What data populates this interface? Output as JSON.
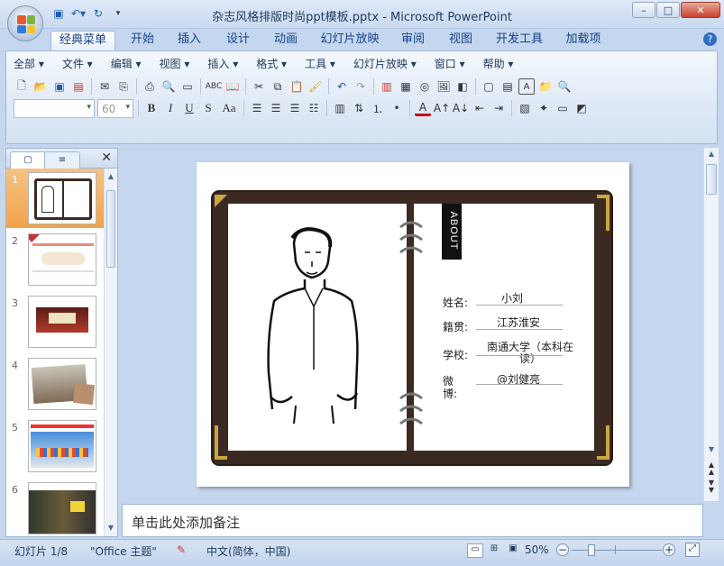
{
  "window": {
    "title": "杂志风格排版时尚ppt模板.pptx - Microsoft PowerPoint",
    "buttons": {
      "minimize": "–",
      "maximize": "□",
      "close": "✕"
    }
  },
  "quick_access": [
    "save-icon",
    "undo-icon",
    "redo-icon",
    "customize-icon"
  ],
  "tabs": [
    {
      "label": "经典菜单",
      "active": true
    },
    {
      "label": "开始"
    },
    {
      "label": "插入"
    },
    {
      "label": "设计"
    },
    {
      "label": "动画"
    },
    {
      "label": "幻灯片放映"
    },
    {
      "label": "审阅"
    },
    {
      "label": "视图"
    },
    {
      "label": "开发工具"
    },
    {
      "label": "加载项"
    }
  ],
  "menu": [
    "全部 ▾",
    "文件 ▾",
    "编辑 ▾",
    "视图 ▾",
    "插入 ▾",
    "格式 ▾",
    "工具 ▾",
    "幻灯片放映 ▾",
    "窗口 ▾",
    "帮助 ▾"
  ],
  "font": {
    "name": "",
    "size": "60"
  },
  "format_buttons": [
    "B",
    "I",
    "U",
    "S",
    "Aa"
  ],
  "left_pane": {
    "close": "✕",
    "slides": [
      "1",
      "2",
      "3",
      "4",
      "5",
      "6"
    ]
  },
  "slide": {
    "about": "ABOUT",
    "fields": [
      {
        "label": "姓名:",
        "value": "小刘"
      },
      {
        "label": "籍贯:",
        "value": "江苏淮安"
      },
      {
        "label": "学校:",
        "value": "南通大学（本科在读）"
      },
      {
        "label": "微博:",
        "value": "@刘健亮"
      }
    ]
  },
  "notes_placeholder": "单击此处添加备注",
  "status": {
    "slide_info": "幻灯片 1/8",
    "theme": "\"Office 主题\"",
    "language": "中文(简体，中国)",
    "zoom": "50%",
    "zoom_minus": "−",
    "zoom_plus": "+"
  },
  "colors": {
    "accent": "#c9a640",
    "book": "#3b2a22",
    "selected_thumb": "#f0a34b"
  }
}
